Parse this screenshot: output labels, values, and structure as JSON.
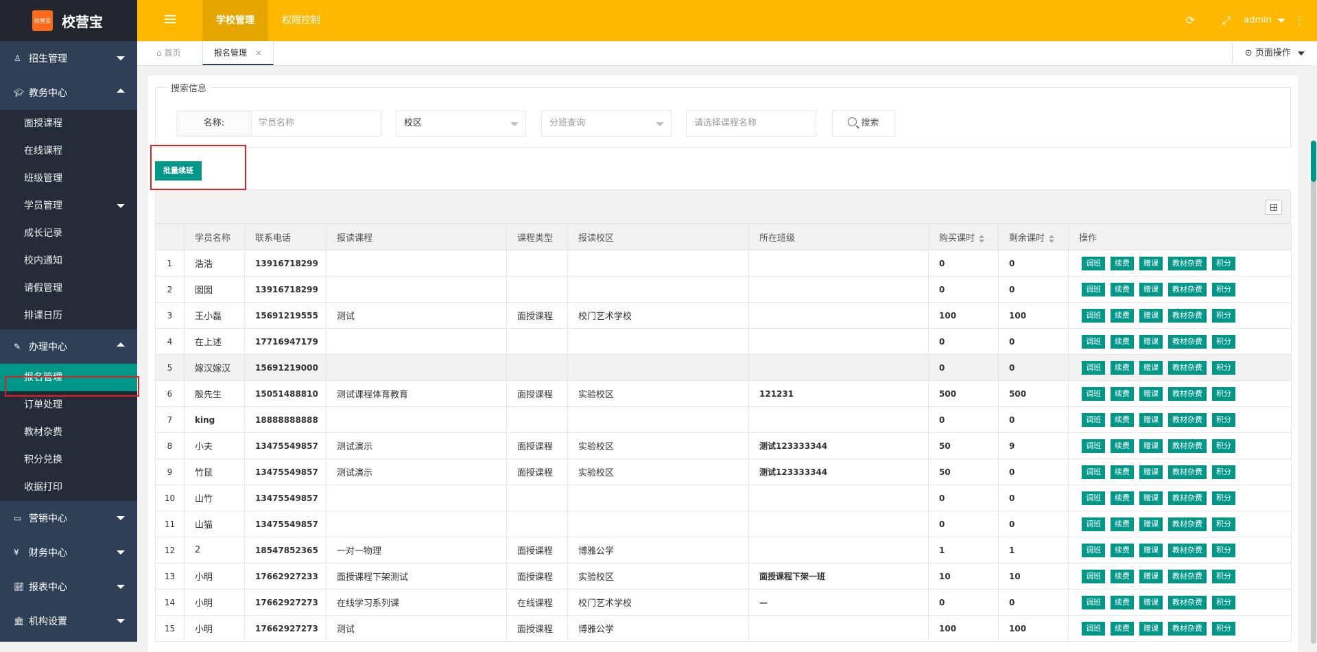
{
  "logo": {
    "badge": "校营宝",
    "title": "校营宝"
  },
  "sidebar": {
    "groups": [
      {
        "label": "招生管理",
        "icon": "person-icon",
        "items": []
      },
      {
        "label": "教务中心",
        "icon": "graduation-cap-icon",
        "items": [
          "面授课程",
          "在线课程",
          "班级管理",
          "学员管理",
          "成长记录",
          "校内通知",
          "请假管理",
          "排课日历"
        ]
      },
      {
        "label": "办理中心",
        "icon": "edit-icon",
        "items": [
          "报名管理",
          "订单处理",
          "教材杂费",
          "积分兑换",
          "收据打印"
        ]
      },
      {
        "label": "营销中心",
        "icon": "laptop-icon",
        "items": []
      },
      {
        "label": "财务中心",
        "icon": "yen-icon",
        "items": []
      },
      {
        "label": "报表中心",
        "icon": "line-chart-icon",
        "items": []
      },
      {
        "label": "机构设置",
        "icon": "bank-icon",
        "items": []
      }
    ],
    "active_item": "报名管理"
  },
  "header": {
    "tabs": [
      "学校管理",
      "权限控制"
    ],
    "active_tab": "学校管理",
    "user": "admin",
    "icons": [
      "refresh-icon",
      "fullscreen-icon",
      "more-vertical-icon"
    ]
  },
  "tabbar": {
    "home": "首页",
    "current": "报名管理",
    "close": "×",
    "page_ops": "页面操作"
  },
  "search": {
    "legend": "搜索信息",
    "name_label": "名称:",
    "name_placeholder": "学员名称",
    "campus_value": "校区",
    "class_placeholder": "分班查询",
    "course_placeholder": "请选择课程名称",
    "search_button": "搜索"
  },
  "batch_button": "批量续班",
  "table": {
    "headers": [
      "",
      "学员名称",
      "联系电话",
      "报读课程",
      "课程类型",
      "报读校区",
      "所在班级",
      "购买课时",
      "剩余课时",
      "操作"
    ],
    "op_labels": [
      "调班",
      "续费",
      "赠课",
      "教材杂费",
      "积分"
    ],
    "rows": [
      [
        "1",
        "浩浩",
        "13916718299",
        "",
        "",
        "",
        "",
        "0",
        "0"
      ],
      [
        "2",
        "囡囡",
        "13916718299",
        "",
        "",
        "",
        "",
        "0",
        "0"
      ],
      [
        "3",
        "王小磊",
        "15691219555",
        "测试",
        "面授课程",
        "校门艺术学校",
        "",
        "100",
        "100"
      ],
      [
        "4",
        "在上述",
        "17716947179",
        "",
        "",
        "",
        "",
        "0",
        "0"
      ],
      [
        "5",
        "嫁汉嫁汉",
        "15691219000",
        "",
        "",
        "",
        "",
        "0",
        "0"
      ],
      [
        "6",
        "殷先生",
        "15051488810",
        "测试课程体育教育",
        "面授课程",
        "实验校区",
        "121231",
        "500",
        "500"
      ],
      [
        "7",
        "king",
        "18888888888",
        "",
        "",
        "",
        "",
        "0",
        "0"
      ],
      [
        "8",
        "小夫",
        "13475549857",
        "测试演示",
        "面授课程",
        "实验校区",
        "测试123333344",
        "50",
        "9"
      ],
      [
        "9",
        "竹鼠",
        "13475549857",
        "测试演示",
        "面授课程",
        "实验校区",
        "测试123333344",
        "50",
        "0"
      ],
      [
        "10",
        "山竹",
        "13475549857",
        "",
        "",
        "",
        "",
        "0",
        "0"
      ],
      [
        "11",
        "山猫",
        "13475549857",
        "",
        "",
        "",
        "",
        "0",
        "0"
      ],
      [
        "12",
        "2",
        "18547852365",
        "一对一物理",
        "面授课程",
        "博雅公学",
        "",
        "1",
        "1"
      ],
      [
        "13",
        "小明",
        "17662927233",
        "面授课程下架测试",
        "面授课程",
        "实验校区",
        "面授课程下架一班",
        "10",
        "10"
      ],
      [
        "14",
        "小明",
        "17662927273",
        "在线学习系列课",
        "在线课程",
        "校门艺术学校",
        "—",
        "0",
        "0"
      ],
      [
        "15",
        "小明",
        "17662927273",
        "测试",
        "面授课程",
        "博雅公学",
        "",
        "100",
        "100"
      ]
    ]
  },
  "colors": {
    "header": "#ffb800",
    "sidebar": "#2f4056",
    "accent": "#009688",
    "highlight": "#e02020"
  }
}
